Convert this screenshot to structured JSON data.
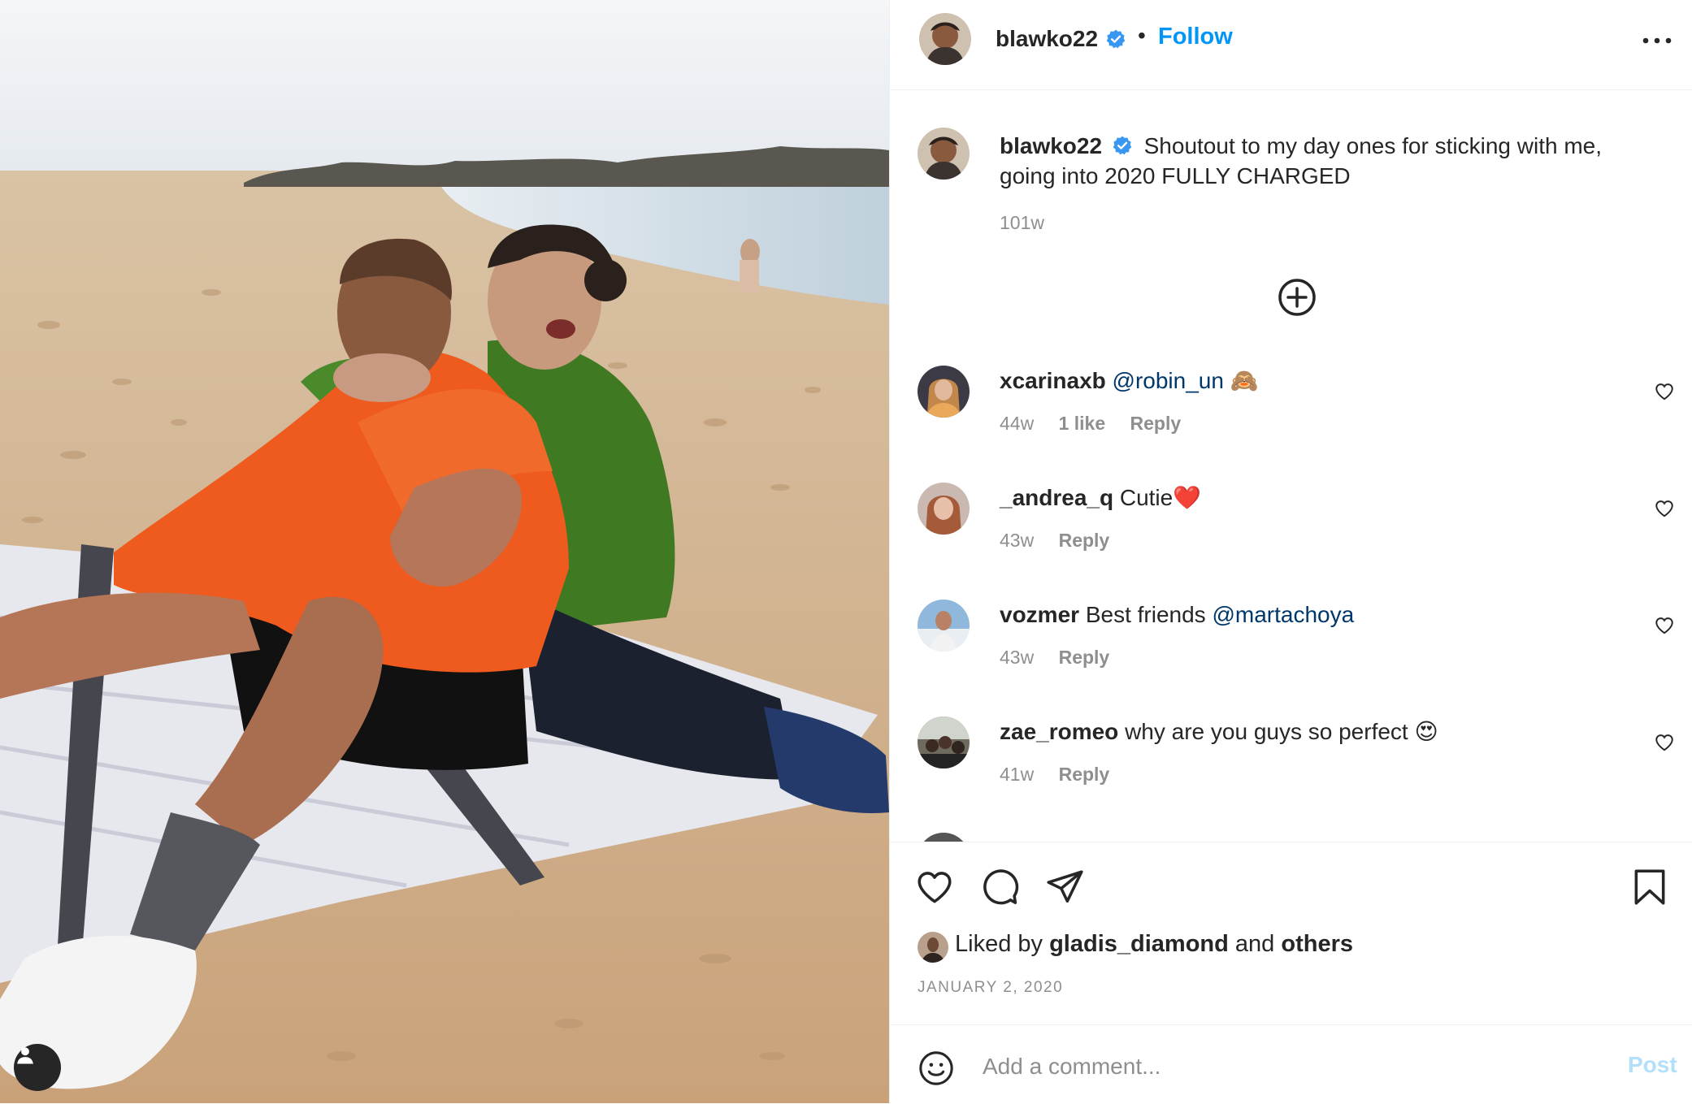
{
  "post": {
    "author": "blawko22",
    "follow_label": "Follow",
    "separator": "•",
    "icons": {
      "verified": "verified-badge-icon",
      "more": "more-options-icon",
      "tag": "user-tag-icon"
    }
  },
  "caption": {
    "username": "blawko22",
    "text": "Shoutout to my day ones for sticking with me, going into 2020 FULLY CHARGED",
    "age": "101w"
  },
  "load_more_icon": "plus-circle-icon",
  "comments": [
    {
      "username": "xcarinaxb",
      "mention": "@robin_un",
      "text": "",
      "emoji": "🙈",
      "age": "44w",
      "likes": "1 like",
      "reply": "Reply"
    },
    {
      "username": "_andrea_q",
      "mention": "",
      "text": "Cutie",
      "emoji": "❤️",
      "age": "43w",
      "likes": "",
      "reply": "Reply"
    },
    {
      "username": "vozmer",
      "mention": "@martachoya",
      "text": "Best friends",
      "emoji": "",
      "age": "43w",
      "likes": "",
      "reply": "Reply"
    },
    {
      "username": "zae_romeo",
      "mention": "",
      "text": "why are you guys so perfect",
      "emoji": "😍",
      "age": "41w",
      "likes": "",
      "reply": "Reply"
    }
  ],
  "actions": {
    "like_icon": "heart-icon",
    "comment_icon": "comment-icon",
    "share_icon": "send-icon",
    "save_icon": "bookmark-icon"
  },
  "likes": {
    "prefix": "Liked by",
    "user": "gladis_diamond",
    "middle": "and",
    "others": "others"
  },
  "date": "JANUARY 2, 2020",
  "add_comment": {
    "placeholder": "Add a comment...",
    "post_label": "Post",
    "emoji_icon": "smiley-icon"
  },
  "colors": {
    "accent": "#0095f6",
    "mention": "#00376b",
    "muted": "#8e8e8e",
    "post_disabled": "#b2dffc",
    "verified": "#3897f0"
  }
}
